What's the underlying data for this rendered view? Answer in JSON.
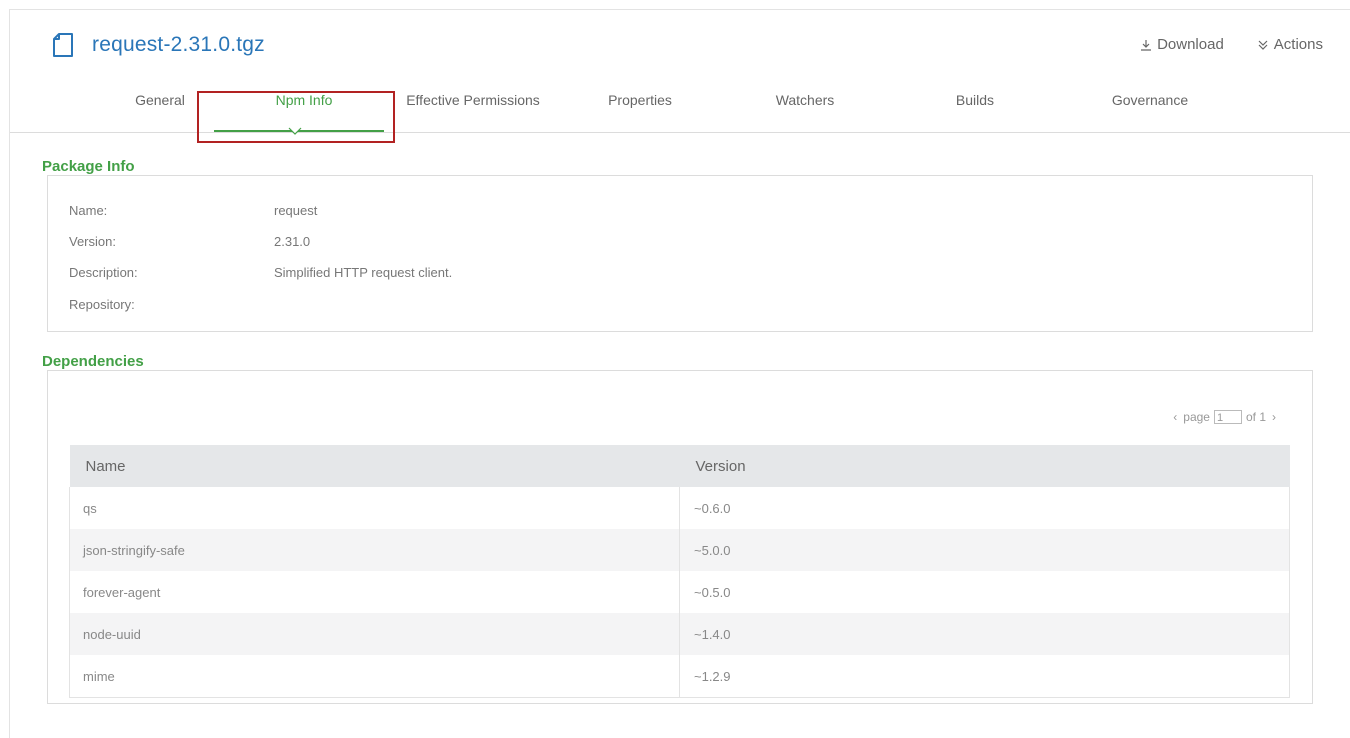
{
  "header": {
    "title": "request-2.31.0.tgz",
    "download_label": "Download",
    "actions_label": "Actions"
  },
  "tabs": [
    {
      "label": "General"
    },
    {
      "label": "Npm Info",
      "active": true
    },
    {
      "label": "Effective Permissions"
    },
    {
      "label": "Properties"
    },
    {
      "label": "Watchers"
    },
    {
      "label": "Builds"
    },
    {
      "label": "Governance"
    }
  ],
  "package_info": {
    "legend": "Package Info",
    "rows": [
      {
        "label": "Name:",
        "value": "request"
      },
      {
        "label": "Version:",
        "value": "2.31.0"
      },
      {
        "label": "Description:",
        "value": "Simplified HTTP request client."
      },
      {
        "label": "Repository:",
        "value": ""
      }
    ]
  },
  "dependencies": {
    "legend": "Dependencies",
    "pager": {
      "prefix": "page",
      "current": "1",
      "suffix": "of 1"
    },
    "columns": [
      "Name",
      "Version"
    ],
    "rows": [
      {
        "name": "qs",
        "version": "~0.6.0"
      },
      {
        "name": "json-stringify-safe",
        "version": "~5.0.0"
      },
      {
        "name": "forever-agent",
        "version": "~0.5.0"
      },
      {
        "name": "node-uuid",
        "version": "~1.4.0"
      },
      {
        "name": "mime",
        "version": "~1.2.9"
      }
    ]
  },
  "colors": {
    "accent": "#43a047",
    "link": "#2a76b8",
    "highlight": "#b22222"
  }
}
